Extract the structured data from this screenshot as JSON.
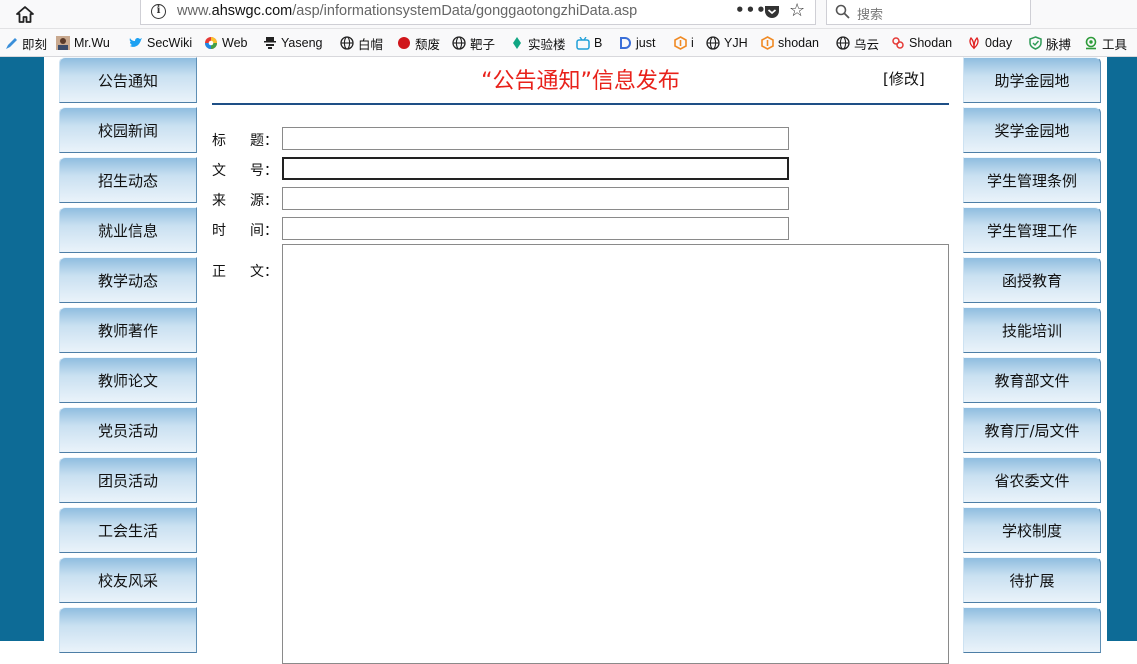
{
  "browser": {
    "url_prefix": "www.",
    "url_host": "ahswgc.com",
    "url_path": "/asp/informationsystemData/gonggaotongzhiData.asp",
    "more_label": "•••",
    "search_placeholder": "搜索"
  },
  "bookmarks": [
    {
      "label": "即刻",
      "icon": "pen-icon"
    },
    {
      "label": "Mr.Wu",
      "icon": "avatar-icon"
    },
    {
      "label": "SecWiki",
      "icon": "twitter-bird-icon"
    },
    {
      "label": "Web",
      "icon": "color-circle-icon"
    },
    {
      "label": "Yaseng",
      "icon": "hat-man-icon"
    },
    {
      "label": "白帽",
      "icon": "globe-icon"
    },
    {
      "label": "颓废",
      "icon": "red-dot-icon"
    },
    {
      "label": "靶子",
      "icon": "globe-icon"
    },
    {
      "label": "实验楼",
      "icon": "leaf-icon"
    },
    {
      "label": "B",
      "icon": "tv-icon"
    },
    {
      "label": "just",
      "icon": "d-icon"
    },
    {
      "label": "i",
      "icon": "hexagon-icon"
    },
    {
      "label": "YJH",
      "icon": "globe-icon"
    },
    {
      "label": "shodan",
      "icon": "hexagon-icon"
    },
    {
      "label": "乌云",
      "icon": "globe-icon"
    },
    {
      "label": "Shodan",
      "icon": "rings-icon"
    },
    {
      "label": "0day",
      "icon": "huawei-icon"
    },
    {
      "label": "脉搏",
      "icon": "shield-icon"
    },
    {
      "label": "工具",
      "icon": "swirl-icon"
    }
  ],
  "left_nav": [
    "公告通知",
    "校园新闻",
    "招生动态",
    "就业信息",
    "教学动态",
    "教师著作",
    "教师论文",
    "党员活动",
    "团员活动",
    "工会生活",
    "校友风采",
    ""
  ],
  "right_nav": [
    "助学金园地",
    "奖学金园地",
    "学生管理条例",
    "学生管理工作",
    "函授教育",
    "技能培训",
    "教育部文件",
    "教育厅/局文件",
    "省农委文件",
    "学校制度",
    "待扩展",
    ""
  ],
  "form": {
    "title": "“公告通知”信息发布",
    "edit_link": "[修改]",
    "fields": [
      {
        "label_a": "标",
        "label_b": "题：",
        "value": ""
      },
      {
        "label_a": "文",
        "label_b": "号：",
        "value": ""
      },
      {
        "label_a": "来",
        "label_b": "源：",
        "value": ""
      },
      {
        "label_a": "时",
        "label_b": "间：",
        "value": ""
      }
    ],
    "body_label_a": "正",
    "body_label_b": "文：",
    "body_value": ""
  },
  "colors": {
    "page_bg": "#0d6b96",
    "title_red": "#e8211a",
    "rule_blue": "#1e4f86"
  }
}
